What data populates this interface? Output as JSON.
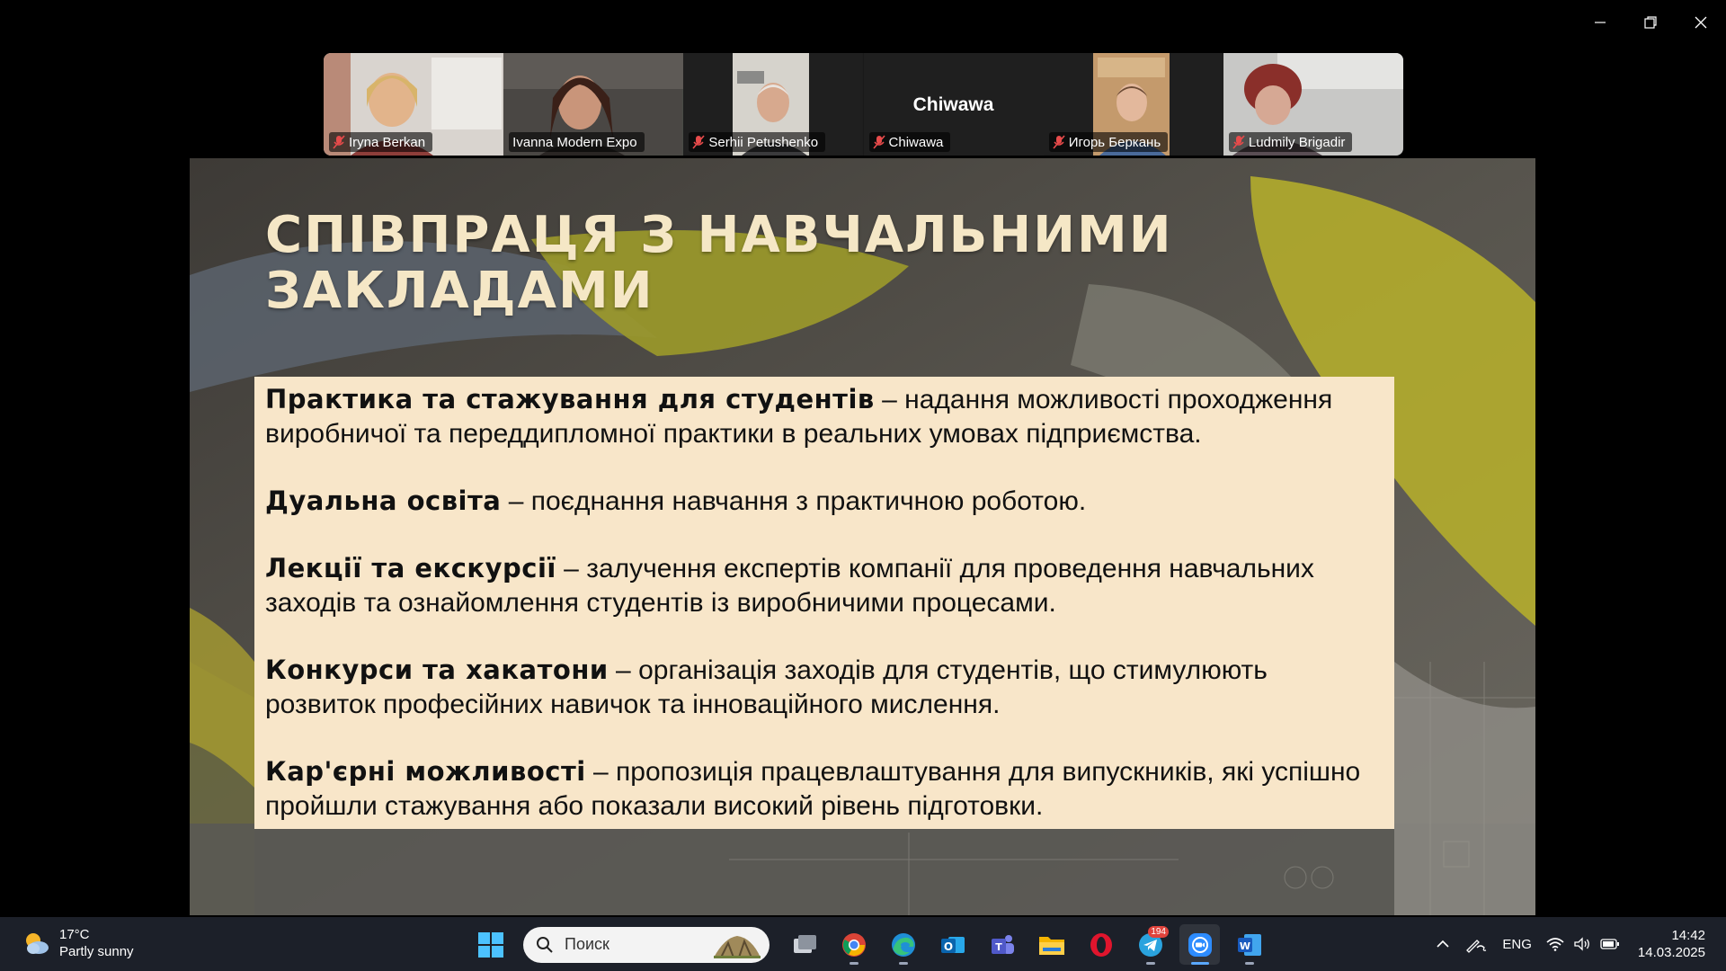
{
  "participants": [
    {
      "name": "Iryna Berkan",
      "muted": true
    },
    {
      "name": "Ivanna Modern Expo",
      "muted": false,
      "active": true
    },
    {
      "name": "Serhii Petushenko",
      "muted": true
    },
    {
      "name": "Chiwawa",
      "muted": true,
      "no_video": true,
      "display_name": "Chiwawa"
    },
    {
      "name": "Игорь Беркань",
      "muted": true
    },
    {
      "name": "Ludmily Brigadir",
      "muted": true
    }
  ],
  "slide": {
    "title_line1": "Співпраця з навчальними",
    "title_line2": "закладами",
    "items": [
      {
        "term": "Практика та стажування для студентів",
        "desc": " – надання можливості проходження виробничої та переддипломної практики в реальних умовах підприємства."
      },
      {
        "term": "Дуальна освіта",
        "desc": " – поєднання навчання з практичною роботою."
      },
      {
        "term": "Лекції та екскурсії",
        "desc": " – залучення експертів компанії для проведення навчальних заходів та ознайомлення студентів із виробничими процесами."
      },
      {
        "term": "Конкурси та хакатони",
        "desc": " – організація заходів для студентів, що стимулюють розвиток професійних навичок та інноваційного мислення."
      },
      {
        "term": "Кар'єрні можливості",
        "desc": " – пропозиція працевлаштування для випускників, які успішно пройшли стажування або показали високий рівень підготовки."
      }
    ]
  },
  "taskbar": {
    "weather_temp": "17°C",
    "weather_desc": "Partly sunny",
    "search_placeholder": "Поиск",
    "telegram_badge": "194",
    "language": "ENG",
    "time": "14:42",
    "date": "14.03.2025"
  },
  "colors": {
    "active_speaker": "#23d160",
    "slide_title": "#f5e7c6",
    "content_bg": "#f8e6c9",
    "taskbar_bg": "#1c2029"
  }
}
